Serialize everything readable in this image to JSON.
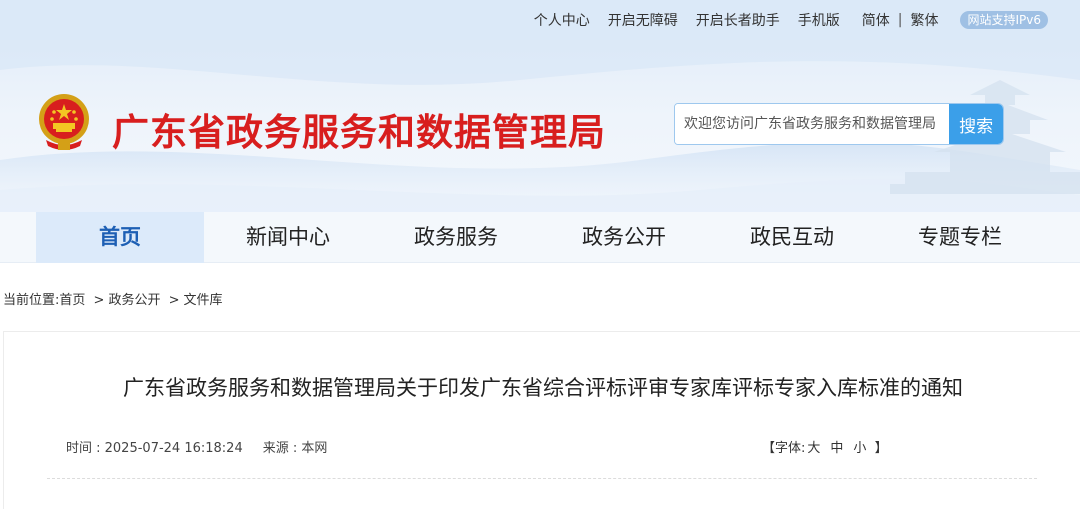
{
  "topbar": {
    "links": [
      "个人中心",
      "开启无障碍",
      "开启长者助手",
      "手机版"
    ],
    "lang_simplified": "简体",
    "lang_separator": "|",
    "lang_traditional": "繁体",
    "ipv6_badge": "网站支持IPv6"
  },
  "header": {
    "title": "广东省政务服务和数据管理局",
    "emblem_icon": "national-emblem-icon",
    "search": {
      "placeholder": "欢迎您访问广东省政务服务和数据管理局",
      "button_label": "搜索"
    }
  },
  "nav": {
    "items": [
      "首页",
      "新闻中心",
      "政务服务",
      "政务公开",
      "政民互动",
      "专题专栏"
    ],
    "active": "首页"
  },
  "breadcrumb": {
    "prefix": "当前位置:",
    "items": [
      "首页",
      "政务公开",
      "文件库"
    ],
    "separator": ">"
  },
  "article": {
    "title": "广东省政务服务和数据管理局关于印发广东省综合评标评审专家库评标专家入库标准的通知",
    "time_label": "时间 : 2025-07-24 16:18:24",
    "source_label": "来源 : 本网",
    "font_size": {
      "open": "【字体:",
      "large": "大",
      "medium": "中",
      "small": "小",
      "close": "】"
    }
  },
  "colors": {
    "title_red": "#d81e1e",
    "accent_blue": "#3b9fe9",
    "nav_active_text": "#1d5fb4",
    "topbar_bg": "#dbe9f8"
  }
}
